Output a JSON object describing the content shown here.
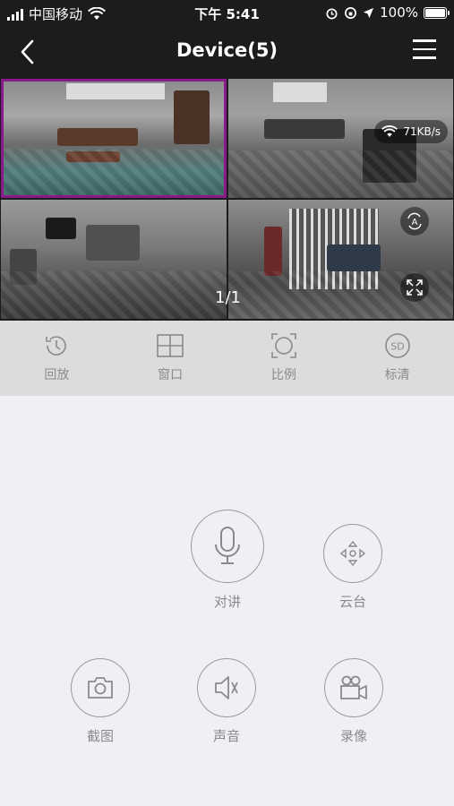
{
  "status": {
    "carrier": "中国移动",
    "time": "下午 5:41",
    "battery": "100%",
    "battery_level": 1.0
  },
  "nav": {
    "title": "Device(5)",
    "back_icon": "chevron-left-icon",
    "menu_icon": "hamburger-menu-icon"
  },
  "video": {
    "speed": "71KB/s",
    "page": "1/1",
    "selected_tile": 1
  },
  "toolbar": [
    {
      "label": "回放",
      "icon": "history-icon"
    },
    {
      "label": "窗口",
      "icon": "grid-window-icon"
    },
    {
      "label": "比例",
      "icon": "aspect-ratio-icon"
    },
    {
      "label": "标清",
      "icon": "sd-quality-icon"
    }
  ],
  "controls": {
    "talk": "对讲",
    "ptz": "云台",
    "snapshot": "截图",
    "sound": "声音",
    "record": "录像"
  },
  "colors": {
    "selected_border": "#8a1a8a",
    "bar_bg": "#1c1c1e",
    "toolbar_bg": "#dcdcdc",
    "page_bg": "#efeff4",
    "icon_gray": "#8a8a8e"
  }
}
